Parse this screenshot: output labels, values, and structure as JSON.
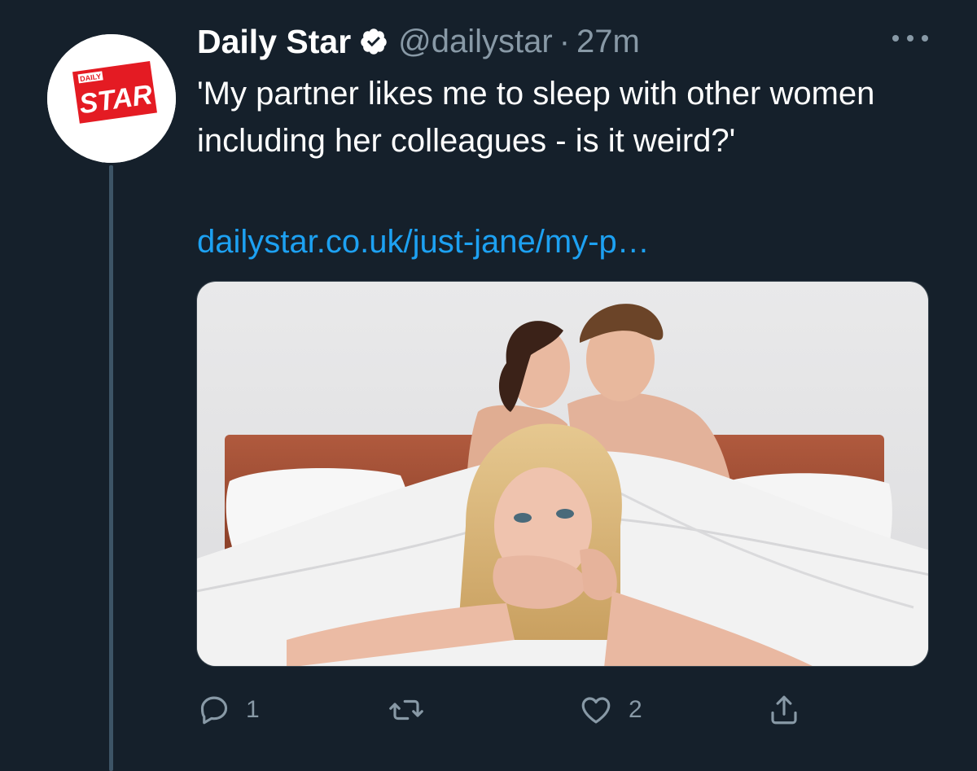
{
  "tweet": {
    "author_name": "Daily Star",
    "handle": "@dailystar",
    "separator": "·",
    "time": "27m",
    "text": "'My partner likes me to sleep with other women including her colleagues - is it weird?'",
    "link": "dailystar.co.uk/just-jane/my-p…"
  },
  "avatar": {
    "logo_text_top": "DAILY",
    "logo_text_main": "STAR"
  },
  "actions": {
    "reply_count": "1",
    "retweet_count": "",
    "like_count": "2"
  },
  "colors": {
    "background": "#15202b",
    "secondary_text": "#8899a6",
    "link": "#1da1f2",
    "brand_red": "#e41b23"
  },
  "icons": {
    "verified": "verified-badge-icon",
    "more": "more-options-icon",
    "reply": "reply-icon",
    "retweet": "retweet-icon",
    "like": "heart-icon",
    "share": "share-icon"
  }
}
